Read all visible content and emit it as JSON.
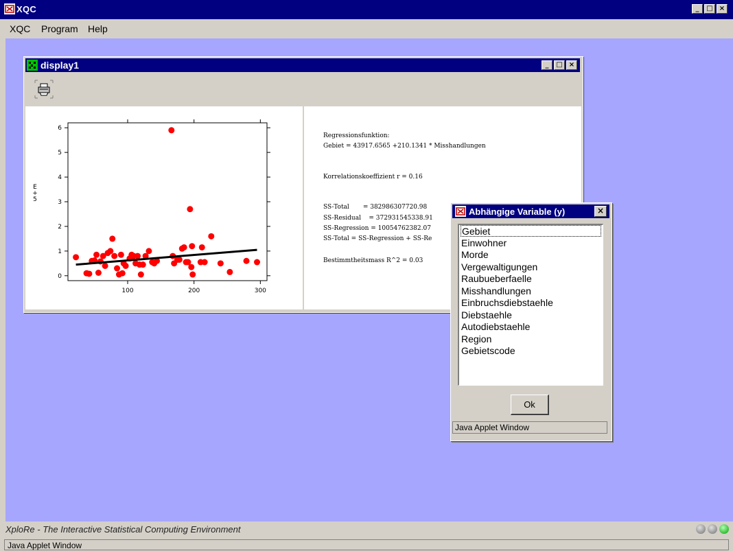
{
  "app": {
    "title": "XQC"
  },
  "menu": [
    "XQC",
    "Program",
    "Help"
  ],
  "status": {
    "text": "XploRe - The Interactive Statistical Computing Environment",
    "applet_window": "Java Applet Window"
  },
  "display": {
    "title": "display1",
    "regression_lines": [
      "Regressionsfunktion:",
      "Gebiet = 43917.6565 +210.1341 * Misshandlungen",
      "Korrelationskoeffizient r = 0.16",
      "SS-Total       = 382986307720.98",
      "SS-Residual    = 372931545338.91",
      "SS-Regression = 10054762382.07",
      "SS-Total = SS-Regression + SS-Re",
      "Bestimmtheitsmass R^2 = 0.03"
    ]
  },
  "chart_data": {
    "type": "scatter",
    "xticks": [
      "100",
      "200",
      "300"
    ],
    "yticks": [
      "0",
      "1",
      "2",
      "3",
      "4",
      "5",
      "6"
    ],
    "ylabel": "E\n+\n5",
    "xlim": [
      10,
      310
    ],
    "ylim": [
      -0.2,
      6.2
    ],
    "points": [
      [
        22,
        0.75
      ],
      [
        38,
        0.1
      ],
      [
        42,
        0.08
      ],
      [
        46,
        0.6
      ],
      [
        50,
        0.62
      ],
      [
        53,
        0.85
      ],
      [
        56,
        0.12
      ],
      [
        59,
        0.58
      ],
      [
        63,
        0.8
      ],
      [
        66,
        0.4
      ],
      [
        70,
        0.92
      ],
      [
        74,
        1.0
      ],
      [
        77,
        1.5
      ],
      [
        80,
        0.8
      ],
      [
        84,
        0.3
      ],
      [
        87,
        0.05
      ],
      [
        90,
        0.85
      ],
      [
        92,
        0.1
      ],
      [
        94,
        0.5
      ],
      [
        97,
        0.4
      ],
      [
        103,
        0.7
      ],
      [
        106,
        0.85
      ],
      [
        109,
        0.8
      ],
      [
        112,
        0.5
      ],
      [
        115,
        0.8
      ],
      [
        118,
        0.45
      ],
      [
        120,
        0.05
      ],
      [
        123,
        0.45
      ],
      [
        127,
        0.8
      ],
      [
        132,
        1.0
      ],
      [
        137,
        0.55
      ],
      [
        140,
        0.5
      ],
      [
        144,
        0.6
      ],
      [
        166,
        5.9
      ],
      [
        168,
        0.8
      ],
      [
        170,
        0.5
      ],
      [
        175,
        0.65
      ],
      [
        178,
        0.65
      ],
      [
        182,
        1.1
      ],
      [
        185,
        1.15
      ],
      [
        188,
        0.55
      ],
      [
        191,
        0.55
      ],
      [
        194,
        2.7
      ],
      [
        196,
        0.35
      ],
      [
        197,
        1.2
      ],
      [
        198,
        0.05
      ],
      [
        210,
        0.55
      ],
      [
        212,
        1.15
      ],
      [
        216,
        0.55
      ],
      [
        226,
        1.6
      ],
      [
        240,
        0.5
      ],
      [
        254,
        0.15
      ],
      [
        279,
        0.6
      ],
      [
        295,
        0.55
      ]
    ],
    "regression_line": [
      [
        22,
        0.45
      ],
      [
        295,
        1.05
      ]
    ]
  },
  "dialog": {
    "title": "Abhängige Variable (y)",
    "items": [
      "Gebiet",
      "Einwohner",
      "Morde",
      "Vergewaltigungen",
      "Raubueberfaelle",
      "Misshandlungen",
      "Einbruchsdiebstaehle",
      "Diebstaehle",
      "Autodiebstaehle",
      "Region",
      "Gebietscode"
    ],
    "selected_index": 0,
    "ok_label": "Ok",
    "status": "Java Applet Window"
  },
  "colors": {
    "titlebar": "#000080",
    "desktop": "#a6a6ff",
    "points": "#ff0000"
  }
}
